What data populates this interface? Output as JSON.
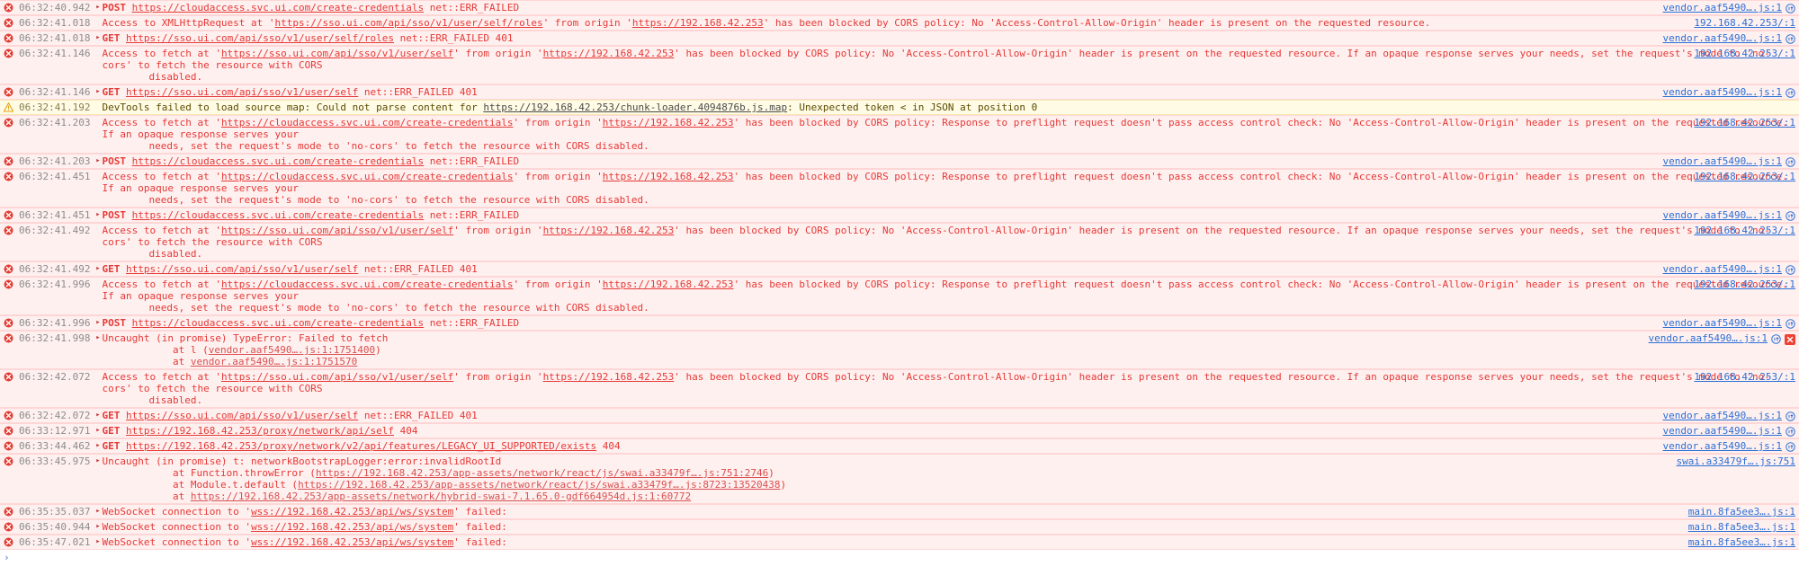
{
  "panel": {
    "name": "devtools-console",
    "prompt_symbol": "›",
    "prompt_value": ""
  },
  "colors": {
    "error_bg": "#fff0f0",
    "error_border": "#ffd6d6",
    "error_text": "#e53935",
    "warning_bg": "#fffbe5",
    "warning_border": "#f5e9b5",
    "link": "#2b6fd4",
    "timestamp": "#8c8c8c",
    "badge_red": "#ef4034"
  },
  "messages": [
    {
      "level": "error",
      "icon": "error-circle-icon",
      "timestamp": "06:32:40.942",
      "expandable": true,
      "lines": [
        [
          {
            "t": "method",
            "v": "POST "
          },
          {
            "t": "link",
            "v": "https://cloudaccess.svc.ui.com/create-credentials"
          },
          {
            "t": "text",
            "v": " net::ERR_FAILED"
          }
        ]
      ],
      "source": "vendor.aaf5490….js:1",
      "source_icon": "network-request-icon",
      "badge": null
    },
    {
      "level": "error",
      "icon": "error-circle-icon",
      "timestamp": "06:32:41.018",
      "expandable": false,
      "lines": [
        [
          {
            "t": "text",
            "v": "Access to XMLHttpRequest at '"
          },
          {
            "t": "link",
            "v": "https://sso.ui.com/api/sso/v1/user/self/roles"
          },
          {
            "t": "text",
            "v": "' from origin '"
          },
          {
            "t": "link",
            "v": "https://192.168.42.253"
          },
          {
            "t": "text",
            "v": "' has been blocked by CORS policy: No 'Access-Control-Allow-Origin' header is present on the requested resource."
          }
        ]
      ],
      "source": "192.168.42.253/:1",
      "source_icon": null,
      "badge": null
    },
    {
      "level": "error",
      "icon": "error-circle-icon",
      "timestamp": "06:32:41.018",
      "expandable": true,
      "lines": [
        [
          {
            "t": "method",
            "v": "GET "
          },
          {
            "t": "link",
            "v": "https://sso.ui.com/api/sso/v1/user/self/roles"
          },
          {
            "t": "text",
            "v": " net::ERR_FAILED 401"
          }
        ]
      ],
      "source": "vendor.aaf5490….js:1",
      "source_icon": "network-request-icon",
      "badge": null
    },
    {
      "level": "error",
      "icon": "error-circle-icon",
      "timestamp": "06:32:41.146",
      "expandable": false,
      "lines": [
        [
          {
            "t": "text",
            "v": "Access to fetch at '"
          },
          {
            "t": "link",
            "v": "https://sso.ui.com/api/sso/v1/user/self"
          },
          {
            "t": "text",
            "v": "' from origin '"
          },
          {
            "t": "link",
            "v": "https://192.168.42.253"
          },
          {
            "t": "text",
            "v": "' has been blocked by CORS policy: No 'Access-Control-Allow-Origin' header is present on the requested resource. If an opaque response serves your needs, set the request's mode to 'no-cors' to fetch the resource with CORS"
          }
        ],
        [
          {
            "t": "indent",
            "v": "disabled."
          }
        ]
      ],
      "source": "192.168.42.253/:1",
      "source_icon": null,
      "badge": null
    },
    {
      "level": "error",
      "icon": "error-circle-icon",
      "timestamp": "06:32:41.146",
      "expandable": true,
      "lines": [
        [
          {
            "t": "method",
            "v": "GET "
          },
          {
            "t": "link",
            "v": "https://sso.ui.com/api/sso/v1/user/self"
          },
          {
            "t": "text",
            "v": " net::ERR_FAILED 401"
          }
        ]
      ],
      "source": "vendor.aaf5490….js:1",
      "source_icon": "network-request-icon",
      "badge": null
    },
    {
      "level": "warning",
      "icon": "warning-triangle-icon",
      "timestamp": "06:32:41.192",
      "expandable": false,
      "lines": [
        [
          {
            "t": "text",
            "v": "DevTools failed to load source map: Could not parse content for "
          },
          {
            "t": "link",
            "v": "https://192.168.42.253/chunk-loader.4094876b.js.map"
          },
          {
            "t": "text",
            "v": ": Unexpected token < in JSON at position 0"
          }
        ]
      ],
      "source": "",
      "source_icon": null,
      "badge": null
    },
    {
      "level": "error",
      "icon": "error-circle-icon",
      "timestamp": "06:32:41.203",
      "expandable": false,
      "lines": [
        [
          {
            "t": "text",
            "v": "Access to fetch at '"
          },
          {
            "t": "link",
            "v": "https://cloudaccess.svc.ui.com/create-credentials"
          },
          {
            "t": "text",
            "v": "' from origin '"
          },
          {
            "t": "link",
            "v": "https://192.168.42.253"
          },
          {
            "t": "text",
            "v": "' has been blocked by CORS policy: Response to preflight request doesn't pass access control check: No 'Access-Control-Allow-Origin' header is present on the requested resource. If an opaque response serves your"
          }
        ],
        [
          {
            "t": "indent",
            "v": "needs, set the request's mode to 'no-cors' to fetch the resource with CORS disabled."
          }
        ]
      ],
      "source": "192.168.42.253/:1",
      "source_icon": null,
      "badge": null
    },
    {
      "level": "error",
      "icon": "error-circle-icon",
      "timestamp": "06:32:41.203",
      "expandable": true,
      "lines": [
        [
          {
            "t": "method",
            "v": "POST "
          },
          {
            "t": "link",
            "v": "https://cloudaccess.svc.ui.com/create-credentials"
          },
          {
            "t": "text",
            "v": " net::ERR_FAILED"
          }
        ]
      ],
      "source": "vendor.aaf5490….js:1",
      "source_icon": "network-request-icon",
      "badge": null
    },
    {
      "level": "error",
      "icon": "error-circle-icon",
      "timestamp": "06:32:41.451",
      "expandable": false,
      "lines": [
        [
          {
            "t": "text",
            "v": "Access to fetch at '"
          },
          {
            "t": "link",
            "v": "https://cloudaccess.svc.ui.com/create-credentials"
          },
          {
            "t": "text",
            "v": "' from origin '"
          },
          {
            "t": "link",
            "v": "https://192.168.42.253"
          },
          {
            "t": "text",
            "v": "' has been blocked by CORS policy: Response to preflight request doesn't pass access control check: No 'Access-Control-Allow-Origin' header is present on the requested resource. If an opaque response serves your"
          }
        ],
        [
          {
            "t": "indent",
            "v": "needs, set the request's mode to 'no-cors' to fetch the resource with CORS disabled."
          }
        ]
      ],
      "source": "192.168.42.253/:1",
      "source_icon": null,
      "badge": null
    },
    {
      "level": "error",
      "icon": "error-circle-icon",
      "timestamp": "06:32:41.451",
      "expandable": true,
      "lines": [
        [
          {
            "t": "method",
            "v": "POST "
          },
          {
            "t": "link",
            "v": "https://cloudaccess.svc.ui.com/create-credentials"
          },
          {
            "t": "text",
            "v": " net::ERR_FAILED"
          }
        ]
      ],
      "source": "vendor.aaf5490….js:1",
      "source_icon": "network-request-icon",
      "badge": null
    },
    {
      "level": "error",
      "icon": "error-circle-icon",
      "timestamp": "06:32:41.492",
      "expandable": false,
      "lines": [
        [
          {
            "t": "text",
            "v": "Access to fetch at '"
          },
          {
            "t": "link",
            "v": "https://sso.ui.com/api/sso/v1/user/self"
          },
          {
            "t": "text",
            "v": "' from origin '"
          },
          {
            "t": "link",
            "v": "https://192.168.42.253"
          },
          {
            "t": "text",
            "v": "' has been blocked by CORS policy: No 'Access-Control-Allow-Origin' header is present on the requested resource. If an opaque response serves your needs, set the request's mode to 'no-cors' to fetch the resource with CORS"
          }
        ],
        [
          {
            "t": "indent",
            "v": "disabled."
          }
        ]
      ],
      "source": "192.168.42.253/:1",
      "source_icon": null,
      "badge": null
    },
    {
      "level": "error",
      "icon": "error-circle-icon",
      "timestamp": "06:32:41.492",
      "expandable": true,
      "lines": [
        [
          {
            "t": "method",
            "v": "GET "
          },
          {
            "t": "link",
            "v": "https://sso.ui.com/api/sso/v1/user/self"
          },
          {
            "t": "text",
            "v": " net::ERR_FAILED 401"
          }
        ]
      ],
      "source": "vendor.aaf5490….js:1",
      "source_icon": "network-request-icon",
      "badge": null
    },
    {
      "level": "error",
      "icon": "error-circle-icon",
      "timestamp": "06:32:41.996",
      "expandable": false,
      "lines": [
        [
          {
            "t": "text",
            "v": "Access to fetch at '"
          },
          {
            "t": "link",
            "v": "https://cloudaccess.svc.ui.com/create-credentials"
          },
          {
            "t": "text",
            "v": "' from origin '"
          },
          {
            "t": "link",
            "v": "https://192.168.42.253"
          },
          {
            "t": "text",
            "v": "' has been blocked by CORS policy: Response to preflight request doesn't pass access control check: No 'Access-Control-Allow-Origin' header is present on the requested resource. If an opaque response serves your"
          }
        ],
        [
          {
            "t": "indent",
            "v": "needs, set the request's mode to 'no-cors' to fetch the resource with CORS disabled."
          }
        ]
      ],
      "source": "192.168.42.253/:1",
      "source_icon": null,
      "badge": null
    },
    {
      "level": "error",
      "icon": "error-circle-icon",
      "timestamp": "06:32:41.996",
      "expandable": true,
      "lines": [
        [
          {
            "t": "method",
            "v": "POST "
          },
          {
            "t": "link",
            "v": "https://cloudaccess.svc.ui.com/create-credentials"
          },
          {
            "t": "text",
            "v": " net::ERR_FAILED"
          }
        ]
      ],
      "source": "vendor.aaf5490….js:1",
      "source_icon": "network-request-icon",
      "badge": null
    },
    {
      "level": "error",
      "icon": "error-circle-icon",
      "timestamp": "06:32:41.998",
      "expandable": true,
      "lines": [
        [
          {
            "t": "text",
            "v": "Uncaught (in promise) TypeError: Failed to fetch"
          }
        ],
        [
          {
            "t": "stack-indent",
            "v": "    at l ("
          },
          {
            "t": "stack-link",
            "v": "vendor.aaf5490….js:1:1751400"
          },
          {
            "t": "stack-text",
            "v": ")"
          }
        ],
        [
          {
            "t": "stack-indent",
            "v": "    at "
          },
          {
            "t": "stack-link",
            "v": "vendor.aaf5490….js:1:1751570"
          }
        ]
      ],
      "source": "vendor.aaf5490….js:1",
      "source_icon": "network-request-icon",
      "badge": "error-x-badge"
    },
    {
      "level": "error",
      "icon": "error-circle-icon",
      "timestamp": "06:32:42.072",
      "expandable": false,
      "lines": [
        [
          {
            "t": "text",
            "v": "Access to fetch at '"
          },
          {
            "t": "link",
            "v": "https://sso.ui.com/api/sso/v1/user/self"
          },
          {
            "t": "text",
            "v": "' from origin '"
          },
          {
            "t": "link",
            "v": "https://192.168.42.253"
          },
          {
            "t": "text",
            "v": "' has been blocked by CORS policy: No 'Access-Control-Allow-Origin' header is present on the requested resource. If an opaque response serves your needs, set the request's mode to 'no-cors' to fetch the resource with CORS"
          }
        ],
        [
          {
            "t": "indent",
            "v": "disabled."
          }
        ]
      ],
      "source": "192.168.42.253/:1",
      "source_icon": null,
      "badge": null
    },
    {
      "level": "error",
      "icon": "error-circle-icon",
      "timestamp": "06:32:42.072",
      "expandable": true,
      "lines": [
        [
          {
            "t": "method",
            "v": "GET "
          },
          {
            "t": "link",
            "v": "https://sso.ui.com/api/sso/v1/user/self"
          },
          {
            "t": "text",
            "v": " net::ERR_FAILED 401"
          }
        ]
      ],
      "source": "vendor.aaf5490….js:1",
      "source_icon": "network-request-icon",
      "badge": null
    },
    {
      "level": "error",
      "icon": "error-circle-icon",
      "timestamp": "06:33:12.971",
      "expandable": true,
      "lines": [
        [
          {
            "t": "method",
            "v": "GET "
          },
          {
            "t": "link",
            "v": "https://192.168.42.253/proxy/network/api/self"
          },
          {
            "t": "text",
            "v": " 404"
          }
        ]
      ],
      "source": "vendor.aaf5490….js:1",
      "source_icon": "network-request-icon",
      "badge": null
    },
    {
      "level": "error",
      "icon": "error-circle-icon",
      "timestamp": "06:33:44.462",
      "expandable": true,
      "lines": [
        [
          {
            "t": "method",
            "v": "GET "
          },
          {
            "t": "link",
            "v": "https://192.168.42.253/proxy/network/v2/api/features/LEGACY_UI_SUPPORTED/exists"
          },
          {
            "t": "text",
            "v": " 404"
          }
        ]
      ],
      "source": "vendor.aaf5490….js:1",
      "source_icon": "network-request-icon",
      "badge": null
    },
    {
      "level": "error",
      "icon": "error-circle-icon",
      "timestamp": "06:33:45.975",
      "expandable": true,
      "lines": [
        [
          {
            "t": "text",
            "v": "Uncaught (in promise) t: networkBootstrapLogger:error:invalidRootId"
          }
        ],
        [
          {
            "t": "stack-indent",
            "v": "    at Function.throwError ("
          },
          {
            "t": "stack-link",
            "v": "https://192.168.42.253/app-assets/network/react/js/swai.a33479f….js:751:2746"
          },
          {
            "t": "stack-text",
            "v": ")"
          }
        ],
        [
          {
            "t": "stack-indent",
            "v": "    at Module.t.default ("
          },
          {
            "t": "stack-link",
            "v": "https://192.168.42.253/app-assets/network/react/js/swai.a33479f….js:8723:13520438"
          },
          {
            "t": "stack-text",
            "v": ")"
          }
        ],
        [
          {
            "t": "stack-indent",
            "v": "    at "
          },
          {
            "t": "stack-link",
            "v": "https://192.168.42.253/app-assets/network/hybrid-swai-7.1.65.0-gdf664954d.js:1:60772"
          }
        ]
      ],
      "source": "swai.a33479f….js:751",
      "source_icon": null,
      "badge": null
    },
    {
      "level": "error",
      "icon": "error-circle-icon",
      "timestamp": "06:35:35.037",
      "expandable": true,
      "lines": [
        [
          {
            "t": "text",
            "v": "WebSocket connection to '"
          },
          {
            "t": "link",
            "v": "wss://192.168.42.253/api/ws/system"
          },
          {
            "t": "text",
            "v": "' failed: "
          }
        ]
      ],
      "source": "main.8fa5ee3….js:1",
      "source_icon": null,
      "badge": null
    },
    {
      "level": "error",
      "icon": "error-circle-icon",
      "timestamp": "06:35:40.944",
      "expandable": true,
      "lines": [
        [
          {
            "t": "text",
            "v": "WebSocket connection to '"
          },
          {
            "t": "link",
            "v": "wss://192.168.42.253/api/ws/system"
          },
          {
            "t": "text",
            "v": "' failed: "
          }
        ]
      ],
      "source": "main.8fa5ee3….js:1",
      "source_icon": null,
      "badge": null
    },
    {
      "level": "error",
      "icon": "error-circle-icon",
      "timestamp": "06:35:47.021",
      "expandable": true,
      "lines": [
        [
          {
            "t": "text",
            "v": "WebSocket connection to '"
          },
          {
            "t": "link",
            "v": "wss://192.168.42.253/api/ws/system"
          },
          {
            "t": "text",
            "v": "' failed: "
          }
        ]
      ],
      "source": "main.8fa5ee3….js:1",
      "source_icon": null,
      "badge": null
    }
  ]
}
